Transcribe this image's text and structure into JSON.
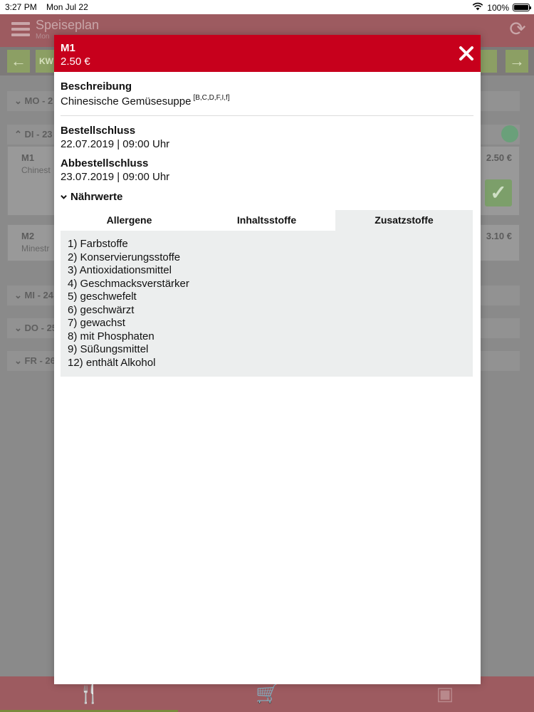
{
  "status_bar": {
    "time": "3:27 PM",
    "date": "Mon Jul 22",
    "battery": "100%",
    "battery_level": 1.0,
    "wifi_icon": "wifi-icon",
    "battery_icon": "battery-icon"
  },
  "app": {
    "title": "Speiseplan",
    "subtitle": "Mon",
    "week_label": "KW",
    "menu_icon": "hamburger-icon",
    "refresh_icon": "refresh-icon"
  },
  "days": [
    {
      "label": "MO - 2"
    },
    {
      "label": "DI - 23"
    },
    {
      "label": "MI - 24"
    },
    {
      "label": "DO - 25"
    },
    {
      "label": "FR - 26"
    }
  ],
  "meal_cards": [
    {
      "code": "M1",
      "desc": "Chinest",
      "price": "2.50 €"
    },
    {
      "code": "M2",
      "desc": "Minestr",
      "price": "3.10 €"
    }
  ],
  "modal": {
    "title": "M1",
    "price": "2.50 €",
    "description_label": "Beschreibung",
    "description": "Chinesische Gemüsesuppe",
    "allergen_codes": "[B,C,D,F,I,f]",
    "order_deadline_label": "Bestellschluss",
    "order_deadline": "22.07.2019 | 09:00 Uhr",
    "cancel_deadline_label": "Abbestellschluss",
    "cancel_deadline": "23.07.2019 | 09:00 Uhr",
    "nutrition_label": "Nährwerte",
    "tabs": [
      {
        "label": "Allergene",
        "active": false
      },
      {
        "label": "Inhaltsstoffe",
        "active": false
      },
      {
        "label": "Zusatzstoffe",
        "active": true
      }
    ],
    "additives": [
      "1) Farbstoffe",
      "2) Konservierungsstoffe",
      "3) Antioxidationsmittel",
      "4) Geschmacksverstärker",
      "5) geschwefelt",
      "6) geschwärzt",
      "7) gewachst",
      "8) mit Phosphaten",
      "9) Süßungsmittel",
      "12) enthält Alkohol"
    ]
  },
  "colors": {
    "header_red": "#c7001c",
    "active_tab_bg": "#eceeee"
  }
}
